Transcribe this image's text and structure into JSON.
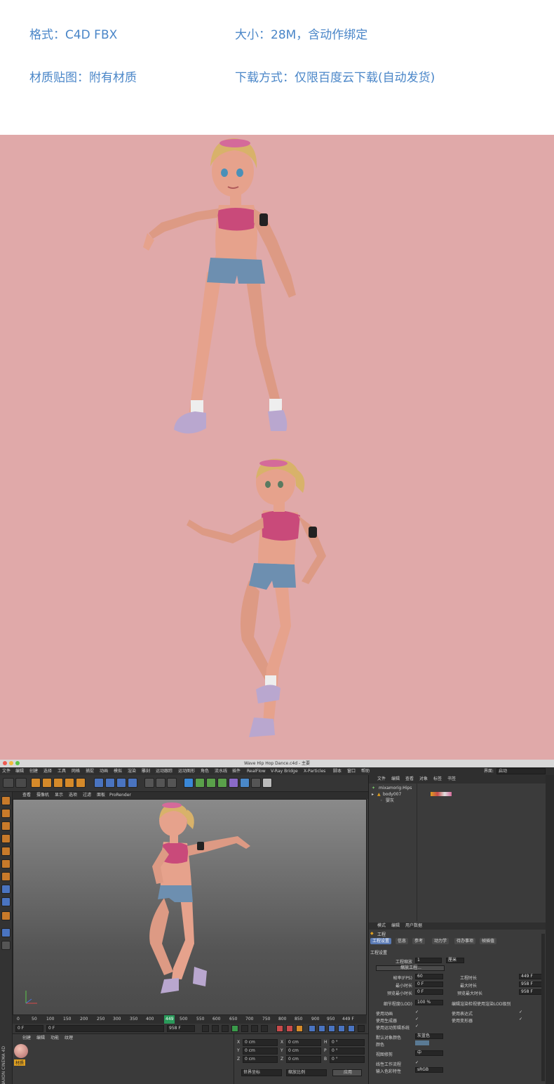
{
  "info": {
    "format": "格式：C4D FBX",
    "size": "大小：28M，含动作绑定",
    "material": "材质贴图：附有材质",
    "download": "下载方式：仅限百度云下载(自动发货)"
  },
  "colors": {
    "info_text": "#4a86c8",
    "preview_bg": "#e0a9a9",
    "top_pink": "#c94a7a",
    "shorts": "#6d8fb0",
    "skin": "#e6a28c",
    "hair": "#d8b26a",
    "sneaker": "#b9a7cf"
  },
  "c4d": {
    "window_title": "Wave Hip Hop Dance.c4d - 主要",
    "menu": [
      "文件",
      "编辑",
      "创建",
      "选择",
      "工具",
      "网格",
      "捕捉",
      "动画",
      "模拟",
      "渲染",
      "雕刻",
      "运动跟踪",
      "运动图形",
      "角色",
      "流水线",
      "插件",
      "RealFlow",
      "V-Ray Bridge",
      "X-Particles",
      "脚本",
      "窗口",
      "帮助"
    ],
    "layout_label": "界面:",
    "layout_value": "启动",
    "viewport_menu": [
      "查看",
      "摄像机",
      "显示",
      "选项",
      "过滤",
      "面板",
      "ProRender"
    ],
    "timeline_ticks": [
      "0",
      "50",
      "100",
      "150",
      "200",
      "250",
      "300",
      "350",
      "400",
      "449",
      "500",
      "550",
      "600",
      "650",
      "700",
      "750",
      "800",
      "850",
      "900",
      "950"
    ],
    "timeline_end": "449 F",
    "play": {
      "start": "0 F",
      "current": "0 F",
      "end_field": "958 F",
      "end": "958 F"
    },
    "material_menu": [
      "创建",
      "编辑",
      "功能",
      "纹理"
    ],
    "material_name": "材质",
    "coords": {
      "rows": [
        {
          "a": "X",
          "a_val": "0 cm",
          "b": "X",
          "b_val": "0 cm",
          "c": "H",
          "c_val": "0 °"
        },
        {
          "a": "Y",
          "a_val": "0 cm",
          "b": "Y",
          "b_val": "0 cm",
          "c": "P",
          "c_val": "0 °"
        },
        {
          "a": "Z",
          "a_val": "0 cm",
          "b": "Z",
          "b_val": "0 cm",
          "c": "B",
          "c_val": "0 °"
        }
      ],
      "mode1": "世界坐标",
      "mode2": "缩放比例",
      "apply": "应用"
    },
    "objects_menu": [
      "文件",
      "编辑",
      "查看",
      "对象",
      "标签",
      "书签"
    ],
    "objects": [
      "mixamorig:Hips",
      "body007",
      "婴灰"
    ],
    "attr_menu": [
      "模式",
      "编辑",
      "用户数据"
    ],
    "attr_title": "工程",
    "attr_tabs": [
      "工程设置",
      "信息",
      "参考",
      "动力学",
      "待办事项",
      "帧插值"
    ],
    "section_title": "工程设置",
    "project_scale_label": "工程缩放",
    "project_scale_value": "1",
    "project_scale_unit": "厘米",
    "scale_button": "缩放工程...",
    "fps_label": "帧率(FPS)",
    "fps_value": "60",
    "min_time_label": "最小时长",
    "min_time_value": "0 F",
    "preview_min_label": "预览最小时长",
    "preview_min_value": "0 F",
    "project_time_label": "工程时长",
    "project_time_value": "449 F",
    "max_time_label": "最大时长",
    "max_time_value": "958 F",
    "preview_max_label": "预览最大时长",
    "preview_max_value": "958 F",
    "lod_label": "细节程度(LOD)",
    "lod_value": "100 %",
    "lod_render_label": "编辑渲染检视使用渲染LOD级别",
    "use_anim": "使用动画",
    "use_gen": "使用生成器",
    "use_motion": "使用运动剪辑系统",
    "use_expr": "使用表达式",
    "use_deform": "使用变形器",
    "default_color_label": "默认对象颜色",
    "default_color_value": "灰蓝色",
    "color_label": "颜色",
    "view_clip_label": "视图修剪",
    "view_clip_value": "中",
    "linear_label": "线性工作流程",
    "input_color_label": "输入色彩特性",
    "input_color_value": "sRGB",
    "maxon": "MAXON CINEMA 4D"
  }
}
